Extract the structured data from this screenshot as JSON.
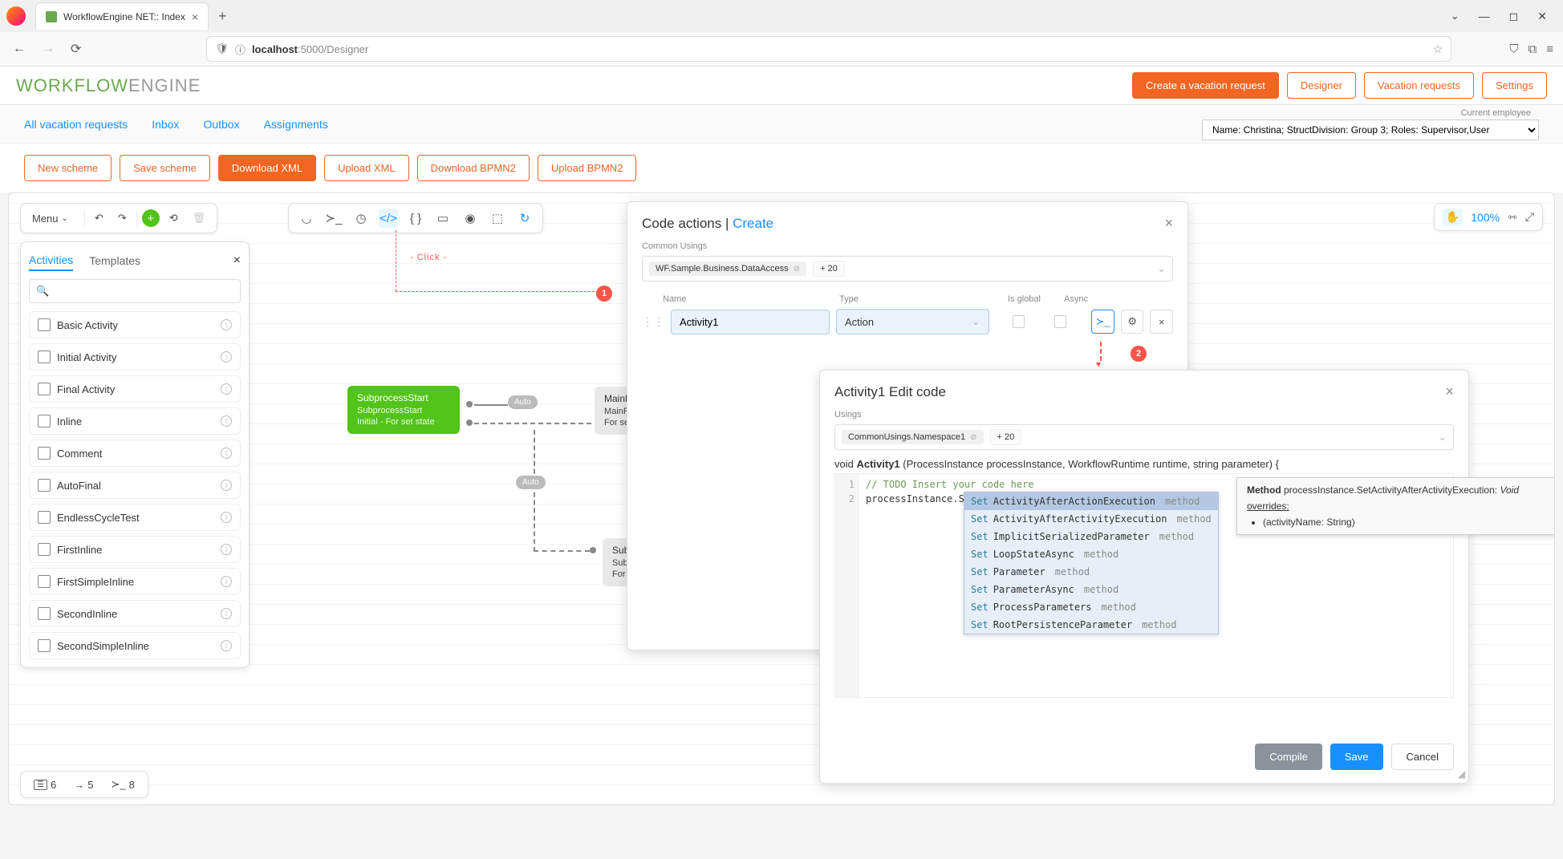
{
  "browser": {
    "tab_title": "WorkflowEngine NET:: Index",
    "address_host": "localhost",
    "address_path": ":5000/Designer"
  },
  "header": {
    "logo_main": "WORKFLOW",
    "logo_sub": "ENGINE",
    "buttons": {
      "create": "Create a vacation request",
      "designer": "Designer",
      "requests": "Vacation requests",
      "settings": "Settings"
    }
  },
  "subnav": {
    "all": "All vacation requests",
    "inbox": "Inbox",
    "outbox": "Outbox",
    "assignments": "Assignments",
    "employee_label": "Current employee",
    "employee_value": "Name: Christina; StructDivision: Group 3; Roles: Supervisor,User"
  },
  "toolbar": {
    "new_scheme": "New scheme",
    "save_scheme": "Save scheme",
    "download_xml": "Download XML",
    "upload_xml": "Upload XML",
    "download_bpmn": "Download BPMN2",
    "upload_bpmn": "Upload BPMN2"
  },
  "float_bar": {
    "menu": "Menu"
  },
  "zoom": {
    "pct": "100%"
  },
  "activities_panel": {
    "tab_activities": "Activities",
    "tab_templates": "Templates",
    "items": [
      "Basic Activity",
      "Initial Activity",
      "Final Activity",
      "Inline",
      "Comment",
      "AutoFinal",
      "EndlessCycleTest",
      "FirstInline",
      "FirstSimpleInline",
      "SecondInline",
      "SecondSimpleInline"
    ]
  },
  "canvas": {
    "node_green_title": "SubprocessStart",
    "node_green_sub1": "SubprocessStart",
    "node_green_sub2": "Initial - For set state",
    "node_mainproc_title": "MainPr",
    "node_mainproc_sub1": "MainPr",
    "node_mainproc_sub2": "For set",
    "node_subwork_title": "SubprocessWork",
    "node_subwork_sub1": "SubprocessWork",
    "node_subwork_sub2": "For set state",
    "auto": "Auto",
    "click_hint": "- Click -"
  },
  "bottom": {
    "stat1": "6",
    "stat2": "5",
    "stat3": "8"
  },
  "code_actions": {
    "title_main": "Code actions",
    "title_sep": " | ",
    "title_create": "Create",
    "common_usings": "Common Usings",
    "tag1": "WF.Sample.Business.DataAccess",
    "plus_tag": "+ 20",
    "col_name": "Name",
    "col_type": "Type",
    "col_global": "Is global",
    "col_async": "Async",
    "row_name": "Activity1",
    "row_type": "Action"
  },
  "edit_code": {
    "title": "Activity1 Edit code",
    "usings_label": "Usings",
    "tag1": "CommonUsings.Namespace1",
    "plus_tag": "+ 20",
    "sig_void": "void ",
    "sig_name": "Activity1",
    "sig_params": " (ProcessInstance processInstance, WorkflowRuntime runtime, string parameter) {",
    "line1": "// TODO Insert your code here",
    "line2": "processInstance.Set",
    "compile": "Compile",
    "save": "Save",
    "cancel": "Cancel"
  },
  "autocomplete": {
    "items": [
      {
        "pre": "Set",
        "suf": "ActivityAfterActionExecution",
        "kind": "method"
      },
      {
        "pre": "Set",
        "suf": "ActivityAfterActivityExecution",
        "kind": "method"
      },
      {
        "pre": "Set",
        "suf": "ImplicitSerializedParameter",
        "kind": "method"
      },
      {
        "pre": "Set",
        "suf": "LoopStateAsync",
        "kind": "method"
      },
      {
        "pre": "Set",
        "suf": "Parameter",
        "kind": "method"
      },
      {
        "pre": "Set",
        "suf": "ParameterAsync",
        "kind": "method"
      },
      {
        "pre": "Set",
        "suf": "ProcessParameters",
        "kind": "method"
      },
      {
        "pre": "Set",
        "suf": "RootPersistenceParameter",
        "kind": "method"
      }
    ]
  },
  "tooltip": {
    "label_method": "Method ",
    "method": "processInstance.SetActivityAfterActivityExecution: ",
    "ret": "Void",
    "overrides": "overrides:",
    "param": "(activityName: String)"
  },
  "callouts": {
    "c1": "1",
    "c2": "2"
  }
}
